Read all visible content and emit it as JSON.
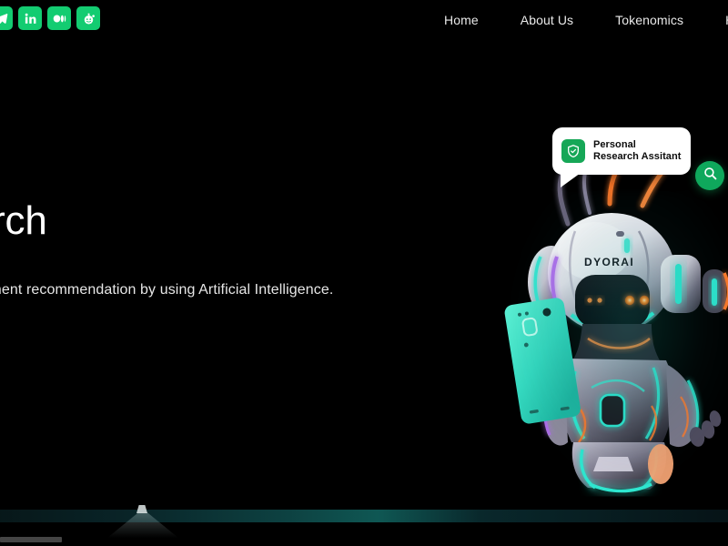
{
  "brand": {
    "robot_label": "DYORAI",
    "accent_green": "#13cc71",
    "accent_green_dark": "#0fa85c",
    "accent_teal": "#2ee6cf",
    "accent_orange": "#ff7a2a",
    "background": "#000000"
  },
  "header": {
    "social": [
      {
        "name": "telegram",
        "label": "Telegram"
      },
      {
        "name": "linkedin",
        "label": "in"
      },
      {
        "name": "medium",
        "label": "Medium"
      },
      {
        "name": "reddit",
        "label": "Reddit"
      }
    ],
    "nav": [
      {
        "label": "Home"
      },
      {
        "label": "About Us"
      },
      {
        "label": "Tokenomics"
      },
      {
        "label": "Hire me"
      }
    ]
  },
  "hero": {
    "title": "research",
    "subtitle": "actors & investment recommendation by using Artificial Intelligence."
  },
  "bubble": {
    "line1": "Personal",
    "line2": "Research Assitant",
    "icon": "shield-check-icon"
  },
  "fab": {
    "icon": "search-icon",
    "label": "Search"
  }
}
